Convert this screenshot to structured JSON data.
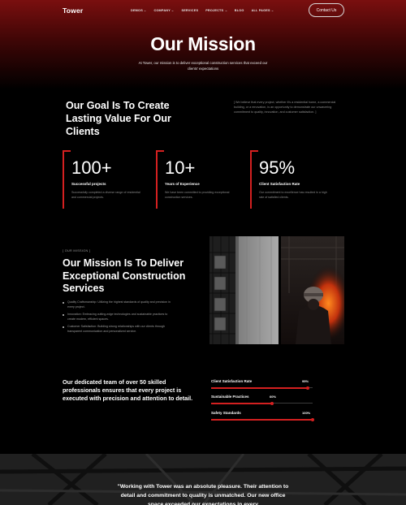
{
  "header": {
    "logo": "Tower",
    "menu": [
      {
        "label": "DEMOS",
        "dropdown": true
      },
      {
        "label": "COMPANY",
        "dropdown": true
      },
      {
        "label": "SERVICES",
        "dropdown": false
      },
      {
        "label": "PROJECTS",
        "dropdown": true
      },
      {
        "label": "BLOG",
        "dropdown": false
      },
      {
        "label": "ALL PAGES",
        "dropdown": true
      }
    ],
    "contact_label": "Contact Us"
  },
  "hero": {
    "title": "Our Mission",
    "subtitle": "At Tower, our mission is to deliver exceptional construction services that exceed our clients' expectations"
  },
  "goal": {
    "title": "Our Goal Is To Create Lasting Value For Our Clients",
    "text": "[ We believe that every project, whether it's a residential home, a commercial building, or a renovation, is an opportunity to demonstrate our unwavering commitment to quality, innovation, and customer satisfaction. ]"
  },
  "stats": [
    {
      "value": "100+",
      "label": "Successful projects",
      "desc": "Successfully completed a diverse range of residential and commercial projects."
    },
    {
      "value": "10+",
      "label": "Years of Experience",
      "desc": "We have been committed to providing exceptional construction services."
    },
    {
      "value": "95%",
      "label": "Client Satisfaction Rate",
      "desc": "Our commitment to excellence has resulted in a high rate of satisfied clients."
    }
  ],
  "mission": {
    "eyebrow": "[ OUR MISSION ]",
    "title": "Our Mission Is To Deliver Exceptional Construction Services",
    "bullets": [
      "Quality Craftsmanship: Utilizing the highest standards of quality and precision in every project.",
      "Innovation: Embracing cutting-edge technologies and sustainable practices to create modern, efficient spaces.",
      "Customer Satisfaction: Building strong relationships with our clients through transparent communication and personalized service."
    ]
  },
  "team": {
    "text": "Our dedicated team of over 50 skilled professionals ensures that every project is executed with precision and attention to detail."
  },
  "progress": [
    {
      "label": "Client Satisfaction Rate",
      "value": "95%",
      "percent": 95
    },
    {
      "label": "Sustainable Practices",
      "value": "60%",
      "percent": 60
    },
    {
      "label": "Safety Standards",
      "value": "100%",
      "percent": 100
    }
  ],
  "testimonial": {
    "quote": "\"Working with Tower was an absolute pleasure. Their attention to detail and commitment to quality is unmatched. Our new office space exceeded our expectations in every"
  },
  "colors": {
    "accent": "#d42020",
    "hero_top": "#7a0f0f",
    "background": "#000000"
  }
}
